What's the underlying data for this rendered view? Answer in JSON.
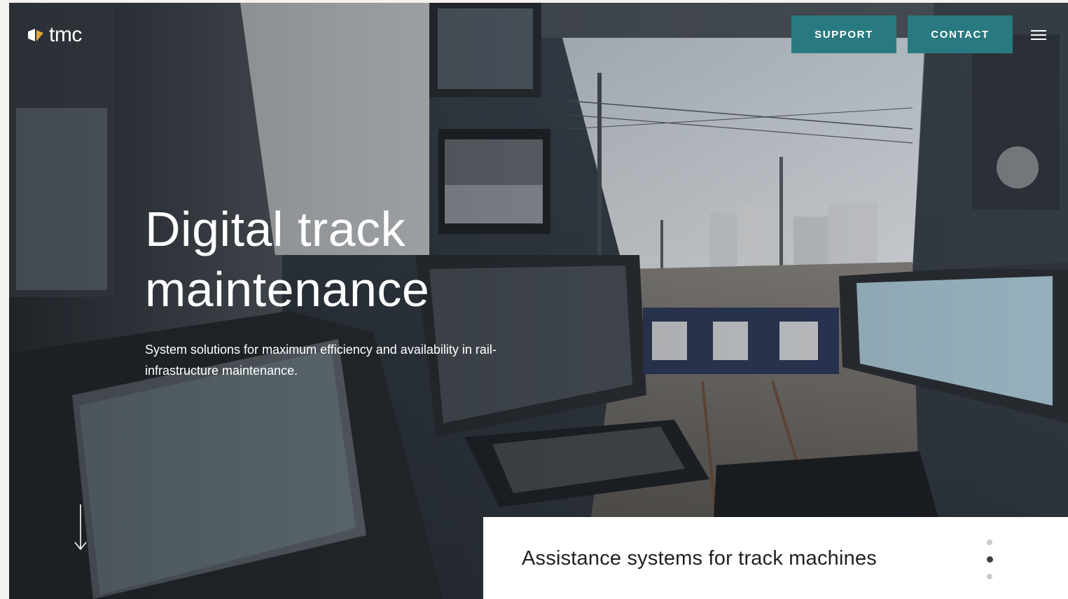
{
  "brand": {
    "logo_text": "tmc",
    "logo_icon": "tmc-logo-mark-icon"
  },
  "header": {
    "support_label": "SUPPORT",
    "contact_label": "CONTACT",
    "menu_icon": "hamburger-menu-icon"
  },
  "hero": {
    "title_line_1": "Digital track",
    "title_line_2": "maintenance",
    "subtitle": "System solutions for maximum efficiency and availability in rail-infrastructure maintenance.",
    "scroll_icon": "arrow-down-icon",
    "image_description_icon": "train-cab-photo"
  },
  "slider": {
    "current_title": "Assistance systems for track machines",
    "dots": [
      {
        "active": false
      },
      {
        "active": true
      },
      {
        "active": false
      }
    ]
  },
  "colors": {
    "accent": "#287a80",
    "text_light": "#ffffff",
    "text_dark": "#1e2124",
    "dot_inactive": "#c9cbcd",
    "dot_active": "#3b3e41"
  }
}
